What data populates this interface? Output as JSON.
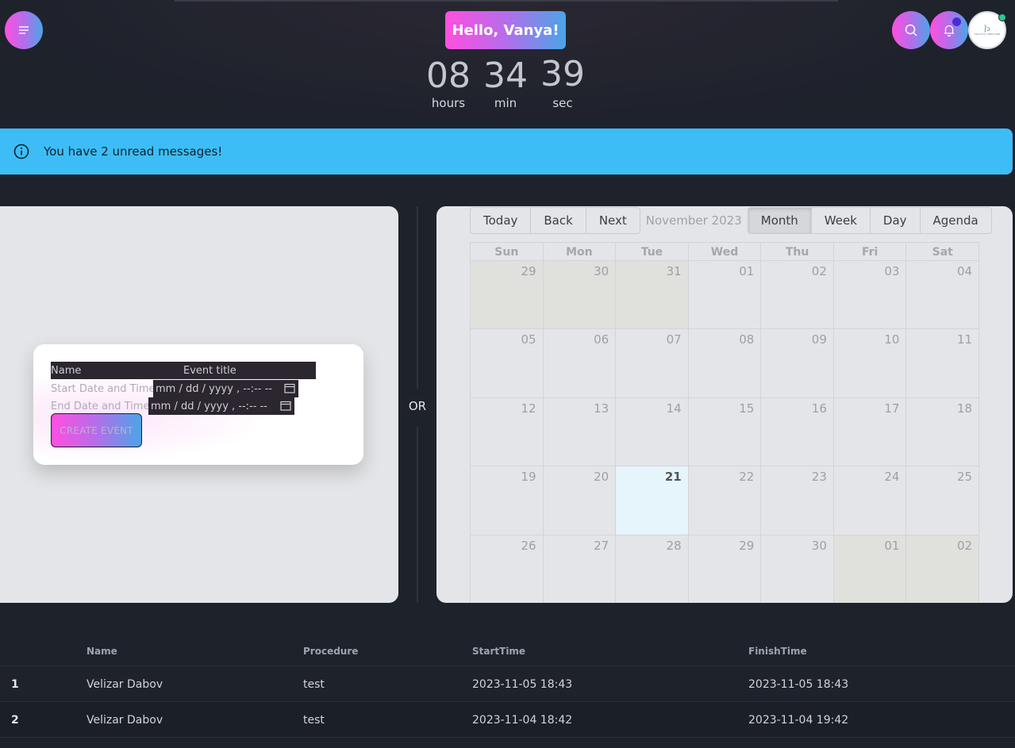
{
  "header": {
    "greeting": "Hello, Vanya!",
    "menu_icon": "hamburger-icon",
    "search_icon": "search-icon",
    "notification_icon": "bell-icon",
    "avatar_logo_mark": "ʃ̃ɔ",
    "avatar_logo_text": "HOLISTIC MEDICINE"
  },
  "timer": {
    "hours": "08",
    "hours_label": "hours",
    "minutes": "34",
    "minutes_label": "min",
    "seconds": "39",
    "seconds_label": "sec"
  },
  "alert": {
    "message": "You have 2 unread messages!",
    "icon": "info-icon"
  },
  "event_form": {
    "name_label": "Name",
    "name_placeholder": "Event title",
    "start_label": "Start Date and Time:",
    "end_label": "End Date and Time:",
    "datetime_placeholder": "mm / dd / yyyy ,  --:--   --",
    "create_button": "CREATE EVENT"
  },
  "or_text": "OR",
  "calendar": {
    "toolbar": {
      "today": "Today",
      "back": "Back",
      "next": "Next",
      "label": "November 2023",
      "views": [
        "Month",
        "Week",
        "Day",
        "Agenda"
      ],
      "active_view": "Month"
    },
    "weekdays": [
      "Sun",
      "Mon",
      "Tue",
      "Wed",
      "Thu",
      "Fri",
      "Sat"
    ],
    "weeks": [
      [
        "29",
        "30",
        "31",
        "01",
        "02",
        "03",
        "04"
      ],
      [
        "05",
        "06",
        "07",
        "08",
        "09",
        "10",
        "11"
      ],
      [
        "12",
        "13",
        "14",
        "15",
        "16",
        "17",
        "18"
      ],
      [
        "19",
        "20",
        "21",
        "22",
        "23",
        "24",
        "25"
      ],
      [
        "26",
        "27",
        "28",
        "29",
        "30",
        "01",
        "02"
      ]
    ],
    "today": "21"
  },
  "table": {
    "headers": [
      "Name",
      "Procedure",
      "StartTime",
      "FinishTime"
    ],
    "rows": [
      {
        "index": "1",
        "name": "Velizar Dabov",
        "procedure": "test",
        "start": "2023-11-05 18:43",
        "finish": "2023-11-05 18:43"
      },
      {
        "index": "2",
        "name": "Velizar Dabov",
        "procedure": "test",
        "start": "2023-11-04 18:42",
        "finish": "2023-11-04 19:42"
      }
    ]
  }
}
